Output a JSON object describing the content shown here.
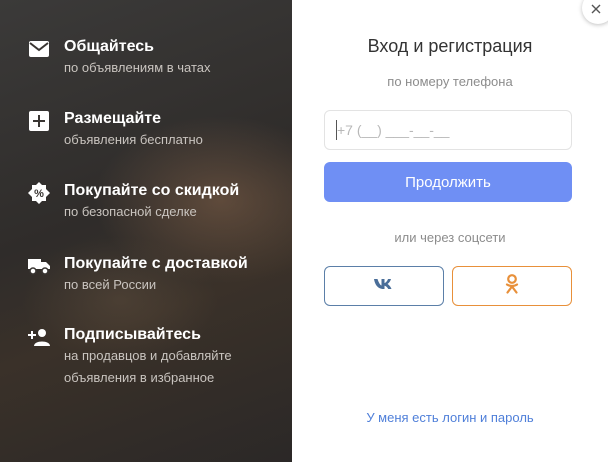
{
  "features": [
    {
      "icon": "mail-icon",
      "title": "Общайтесь",
      "sub": "по объявлениям в чатах",
      "sub2": ""
    },
    {
      "icon": "plus-square-icon",
      "title": "Размещайте",
      "sub": "объявления бесплатно",
      "sub2": ""
    },
    {
      "icon": "discount-badge-icon",
      "title": "Покупайте со скидкой",
      "sub": "по безопасной сделке",
      "sub2": ""
    },
    {
      "icon": "truck-icon",
      "title": "Покупайте с доставкой",
      "sub": "по всей России",
      "sub2": ""
    },
    {
      "icon": "add-person-icon",
      "title": "Подписывайтесь",
      "sub": "на продавцов и добавляйте",
      "sub2": "объявления в избранное"
    }
  ],
  "auth": {
    "title": "Вход и регистрация",
    "subtitle": "по номеру телефона",
    "phone_placeholder": "+7 (__) ___-__-__",
    "continue_label": "Продолжить",
    "or_label": "или через соцсети",
    "login_link": "У меня есть логин и пароль"
  },
  "colors": {
    "primary": "#6f8ff4",
    "vk": "#5b7fa8",
    "ok": "#e8903a",
    "link": "#4f7fd9"
  }
}
